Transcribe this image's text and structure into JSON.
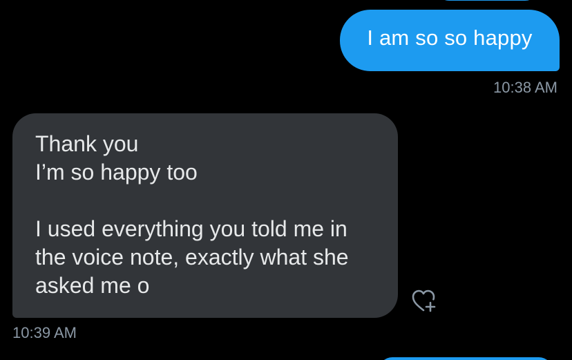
{
  "messages": [
    {
      "direction": "sent",
      "text": "I am so so happy",
      "time": "10:38 AM"
    },
    {
      "direction": "received",
      "lines": [
        "Thank you",
        "I’m so happy too",
        "",
        "I used everything you told me in",
        "the voice note, exactly what she",
        "asked me o"
      ],
      "time": "10:39 AM"
    }
  ],
  "icons": {
    "reaction": "heart-plus-icon"
  },
  "colors": {
    "background": "#000000",
    "sent_bubble": "#1d9bf0",
    "received_bubble": "#323539",
    "timestamp": "#8b98a5"
  }
}
